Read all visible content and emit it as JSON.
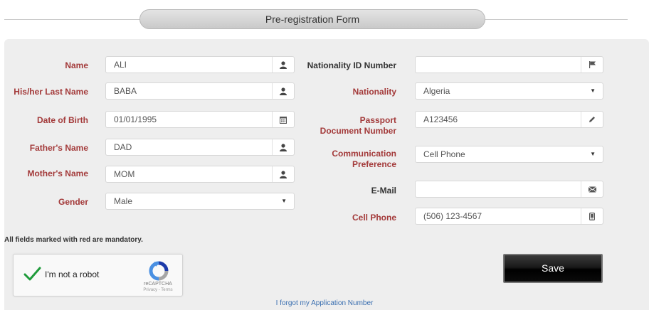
{
  "form": {
    "title": "Pre-registration Form",
    "mandatory_note": "All fields marked with red are mandatory.",
    "save_label": "Save",
    "forgot_link": "I forgot my Application Number"
  },
  "left_fields": [
    {
      "label": "Name",
      "value": "ALI",
      "icon": "user-icon"
    },
    {
      "label": "His/her Last Name",
      "value": "BABA",
      "icon": "user-icon"
    },
    {
      "label": "Date of Birth",
      "value": "01/01/1995",
      "icon": "calendar-icon"
    },
    {
      "label": "Father's Name",
      "value": "DAD",
      "icon": "user-icon"
    },
    {
      "label": "Mother's Name",
      "value": "MOM",
      "icon": "user-icon"
    },
    {
      "label": "Gender",
      "value": "Male",
      "icon": "chevron-down-icon"
    }
  ],
  "right_fields": [
    {
      "label": "Nationality ID Number",
      "value": "",
      "icon": "flag-icon"
    },
    {
      "label": "Nationality",
      "value": "Algeria",
      "icon": "chevron-down-icon"
    },
    {
      "label": "Passport Document Number",
      "value": "A123456",
      "icon": "pencil-icon"
    },
    {
      "label": "Communication Preference",
      "value": "Cell Phone",
      "icon": "chevron-down-icon"
    },
    {
      "label": "E-Mail",
      "value": "",
      "icon": "envelope-icon"
    },
    {
      "label": "Cell Phone",
      "value": "(506) 123-4567",
      "icon": "mobile-phone-icon"
    }
  ],
  "captcha": {
    "label": "I'm not a robot",
    "brand": "reCAPTCHA",
    "privacy": "Privacy",
    "separator": " - ",
    "terms": "Terms"
  },
  "colors": {
    "required_label": "#a33a3a",
    "panel_bg": "#eeeeee",
    "link": "#3a6fb0",
    "check": "#1f9b3b"
  }
}
